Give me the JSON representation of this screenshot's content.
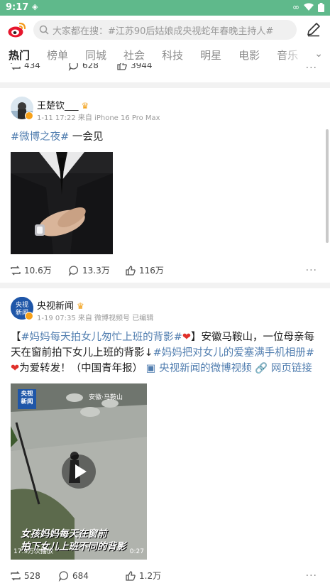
{
  "status": {
    "time": "9:17"
  },
  "header": {
    "search_placeholder": "大家都在搜：#江苏90后姑娘成央视蛇年春晚主持人#"
  },
  "tabs": [
    "热门",
    "榜单",
    "同城",
    "社会",
    "科技",
    "明星",
    "电影",
    "音乐"
  ],
  "prev_post": {
    "repost": "434",
    "comment": "628",
    "like": "3944"
  },
  "post1": {
    "author": "王楚钦___",
    "meta": "1-11 17:22 来自 iPhone 16 Pro Max",
    "tag": "#微博之夜#",
    "text": " 一会见",
    "repost": "10.6万",
    "comment": "13.3万",
    "like": "116万"
  },
  "post2": {
    "author": "央视新闻",
    "meta": "1-19 07:35 来自 微博视频号 已编辑",
    "bracket_open": "【",
    "tag1": "#妈妈每天拍女儿匆忙上班的背影#",
    "bracket_close": "】",
    "text1": "安徽马鞍山，一位母亲每天在窗前拍下女儿上班的背影↓",
    "tag2": "#妈妈把对女儿的爱塞满手机相册#",
    "text2": "为爱转发！（中国青年报）",
    "video_link": "央视新闻的微博视频",
    "web_link": "网页链接",
    "video": {
      "location": "安徽·马鞍山",
      "caption_line1": "女孩妈妈每天在窗前",
      "caption_line2": "拍下女儿上班不同的背影",
      "views": "17.9万次播放",
      "duration": "0:27"
    },
    "repost": "528",
    "comment": "684",
    "like": "1.2万"
  },
  "colors": {
    "status_bar": "#5fb98b",
    "link": "#507daf",
    "tab_active": "#222222"
  }
}
